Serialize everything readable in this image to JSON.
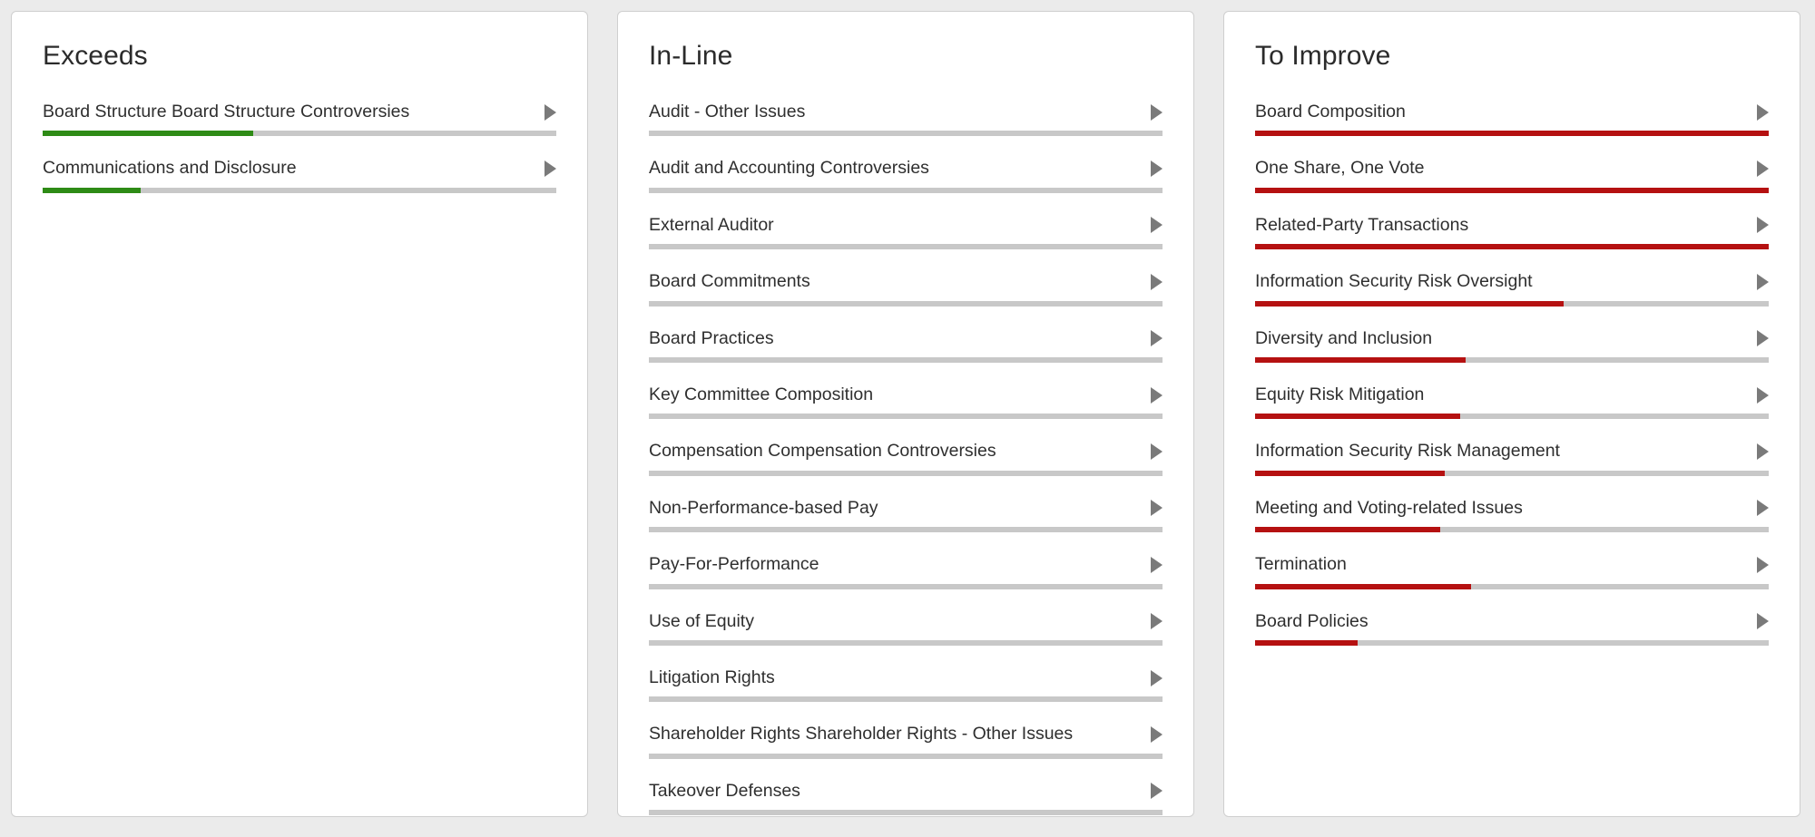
{
  "theme": {
    "page_background": "#ebebeb",
    "card_background": "#ffffff",
    "card_border": "#cfcfcf",
    "track_color": "#c8c8c8",
    "exceeds_color": "#2e8b16",
    "to_improve_color": "#b51111",
    "caret_color": "#7a7a7a",
    "text_color": "#2f2f2f"
  },
  "icons": {
    "expand": "caret-right-icon"
  },
  "columns": [
    {
      "id": "exceeds",
      "title": "Exceeds",
      "bar_style": "green",
      "items": [
        {
          "label": "Board Structure Board Structure Controversies",
          "fill_percent": 41
        },
        {
          "label": "Communications and Disclosure",
          "fill_percent": 19
        }
      ]
    },
    {
      "id": "in-line",
      "title": "In-Line",
      "bar_style": "none",
      "items": [
        {
          "label": "Audit - Other Issues",
          "fill_percent": 0
        },
        {
          "label": "Audit and Accounting Controversies",
          "fill_percent": 0
        },
        {
          "label": "External Auditor",
          "fill_percent": 0
        },
        {
          "label": "Board Commitments",
          "fill_percent": 0
        },
        {
          "label": "Board Practices",
          "fill_percent": 0
        },
        {
          "label": "Key Committee Composition",
          "fill_percent": 0
        },
        {
          "label": "Compensation Compensation Controversies",
          "fill_percent": 0
        },
        {
          "label": "Non-Performance-based Pay",
          "fill_percent": 0
        },
        {
          "label": "Pay-For-Performance",
          "fill_percent": 0
        },
        {
          "label": "Use of Equity",
          "fill_percent": 0
        },
        {
          "label": "Litigation Rights",
          "fill_percent": 0
        },
        {
          "label": "Shareholder Rights Shareholder Rights - Other Issues",
          "fill_percent": 0
        },
        {
          "label": "Takeover Defenses",
          "fill_percent": 0
        }
      ]
    },
    {
      "id": "to-improve",
      "title": "To Improve",
      "bar_style": "red",
      "items": [
        {
          "label": "Board Composition",
          "fill_percent": 100
        },
        {
          "label": "One Share, One Vote",
          "fill_percent": 100
        },
        {
          "label": "Related-Party Transactions",
          "fill_percent": 100
        },
        {
          "label": "Information Security Risk Oversight",
          "fill_percent": 60
        },
        {
          "label": "Diversity and Inclusion",
          "fill_percent": 41
        },
        {
          "label": "Equity Risk Mitigation",
          "fill_percent": 40
        },
        {
          "label": "Information Security Risk Management",
          "fill_percent": 37
        },
        {
          "label": "Meeting and Voting-related Issues",
          "fill_percent": 36
        },
        {
          "label": "Termination",
          "fill_percent": 42
        },
        {
          "label": "Board Policies",
          "fill_percent": 20
        }
      ]
    }
  ],
  "chart_data": {
    "type": "bar",
    "title": "Governance Scorecard by Category",
    "orientation": "horizontal",
    "grid": false,
    "legend": "none",
    "xlabel": "",
    "ylabel": "",
    "ylim": [
      0,
      100
    ],
    "groups": [
      {
        "name": "Exceeds",
        "color": "#2e8b16",
        "categories": [
          "Board Structure Board Structure Controversies",
          "Communications and Disclosure"
        ],
        "values": [
          41,
          19
        ]
      },
      {
        "name": "In-Line",
        "color": "#c8c8c8",
        "categories": [
          "Audit - Other Issues",
          "Audit and Accounting Controversies",
          "External Auditor",
          "Board Commitments",
          "Board Practices",
          "Key Committee Composition",
          "Compensation Compensation Controversies",
          "Non-Performance-based Pay",
          "Pay-For-Performance",
          "Use of Equity",
          "Litigation Rights",
          "Shareholder Rights Shareholder Rights - Other Issues",
          "Takeover Defenses"
        ],
        "values": [
          0,
          0,
          0,
          0,
          0,
          0,
          0,
          0,
          0,
          0,
          0,
          0,
          0
        ]
      },
      {
        "name": "To Improve",
        "color": "#b51111",
        "categories": [
          "Board Composition",
          "One Share, One Vote",
          "Related-Party Transactions",
          "Information Security Risk Oversight",
          "Diversity and Inclusion",
          "Equity Risk Mitigation",
          "Information Security Risk Management",
          "Meeting and Voting-related Issues",
          "Termination",
          "Board Policies"
        ],
        "values": [
          100,
          100,
          100,
          60,
          41,
          40,
          37,
          36,
          42,
          20
        ]
      }
    ]
  }
}
